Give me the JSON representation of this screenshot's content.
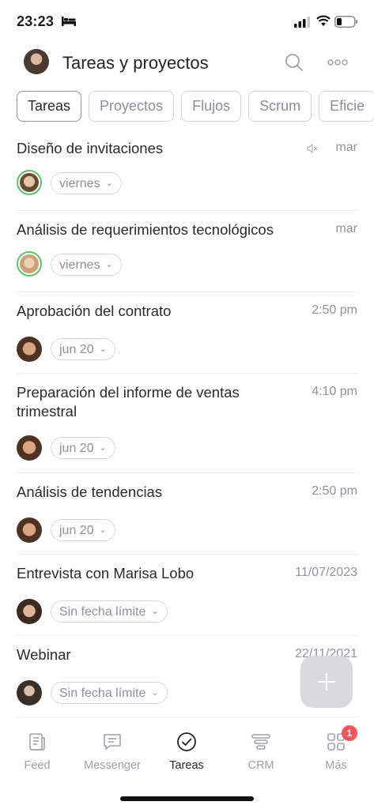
{
  "status_bar": {
    "time": "23:23"
  },
  "header": {
    "title": "Tareas y proyectos"
  },
  "tabs": [
    {
      "label": "Tareas",
      "active": true
    },
    {
      "label": "Proyectos",
      "active": false
    },
    {
      "label": "Flujos",
      "active": false
    },
    {
      "label": "Scrum",
      "active": false
    },
    {
      "label": "Eficie",
      "active": false
    }
  ],
  "tasks": [
    {
      "title": "Diseño de invitaciones",
      "time": "mar",
      "muted": true,
      "deadline": "viernes",
      "avatar": "male-ringed"
    },
    {
      "title": "Análisis de requerimientos tecnológicos",
      "time": "mar",
      "muted": false,
      "deadline": "viernes",
      "avatar": "female-ringed"
    },
    {
      "title": "Aprobación del contrato",
      "time": "2:50 pm",
      "muted": false,
      "deadline": "jun 20",
      "avatar": "female-curly"
    },
    {
      "title": "Preparación del informe de ventas trimestral",
      "time": "4:10 pm",
      "muted": false,
      "deadline": "jun 20",
      "avatar": "female-curly"
    },
    {
      "title": "Análisis de tendencias",
      "time": "2:50 pm",
      "muted": false,
      "deadline": "jun 20",
      "avatar": "female-curly"
    },
    {
      "title": "Entrevista con Marisa Lobo",
      "time": "11/07/2023",
      "muted": false,
      "deadline": "Sin fecha límite",
      "avatar": "female-dark"
    },
    {
      "title": "Webinar",
      "time": "22/11/2021",
      "muted": false,
      "deadline": "Sin fecha límite",
      "avatar": "female-blonde"
    }
  ],
  "bottom_nav": [
    {
      "label": "Feed",
      "icon": "feed-icon",
      "active": false
    },
    {
      "label": "Messenger",
      "icon": "messenger-icon",
      "active": false
    },
    {
      "label": "Tareas",
      "icon": "check-circle-icon",
      "active": true
    },
    {
      "label": "CRM",
      "icon": "crm-icon",
      "active": false
    },
    {
      "label": "Más",
      "icon": "grid-icon",
      "active": false,
      "badge": "1"
    }
  ],
  "colors": {
    "ring": "#5bc26a",
    "badge": "#f4545a",
    "fab": "#d8dadd"
  }
}
